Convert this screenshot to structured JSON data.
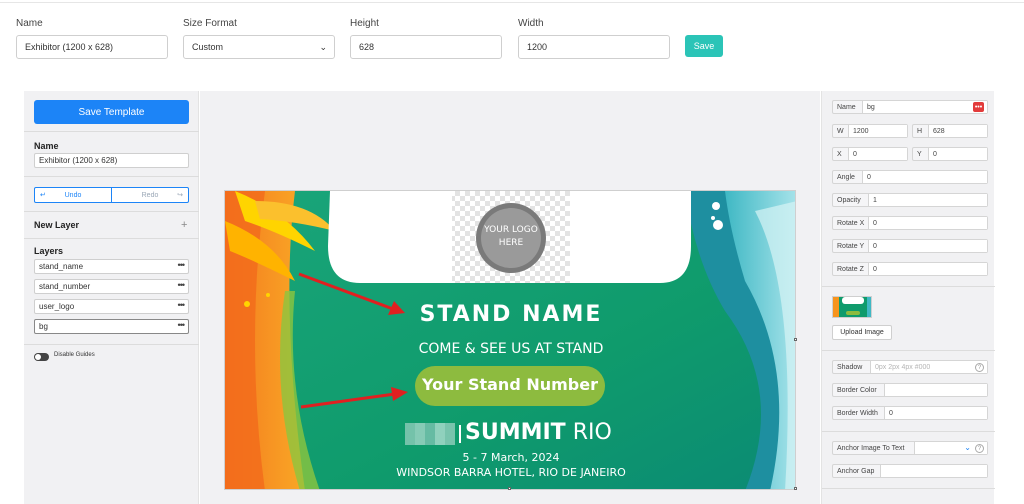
{
  "topbar": {
    "name_label": "Name",
    "name_value": "Exhibitor (1200 x 628)",
    "size_format_label": "Size Format",
    "size_format_value": "Custom",
    "height_label": "Height",
    "height_value": "628",
    "width_label": "Width",
    "width_value": "1200",
    "save_label": "Save"
  },
  "left_panel": {
    "save_template_label": "Save Template",
    "name_heading": "Name",
    "name_value": "Exhibitor (1200 x 628)",
    "undo_label": "Undo",
    "redo_label": "Redo",
    "new_layer_label": "New Layer",
    "layers_heading": "Layers",
    "layers": [
      {
        "label": "stand_name"
      },
      {
        "label": "stand_number"
      },
      {
        "label": "user_logo"
      },
      {
        "label": "bg"
      }
    ],
    "disable_guides_label": "Disable Guides"
  },
  "canvas": {
    "logo_text": "YOUR LOGO HERE",
    "stand_name": "STAND NAME",
    "come_see": "COME & SEE US AT STAND",
    "stand_number": "Your Stand Number",
    "summit": "SUMMIT",
    "city": "RIO",
    "dates": "5 - 7 March, 2024",
    "venue": "WINDSOR BARRA HOTEL, RIO DE JANEIRO",
    "colors": {
      "green": "#0f9b6c",
      "teal": "#2bb3b0",
      "orange": "#f7941d",
      "yellow": "#ffd400",
      "pill": "#8dbb3f",
      "arrow": "#e02020"
    }
  },
  "right_panel": {
    "name_label": "Name",
    "name_value": "bg",
    "w_label": "W",
    "w_value": "1200",
    "h_label": "H",
    "h_value": "628",
    "x_label": "X",
    "x_value": "0",
    "y_label": "Y",
    "y_value": "0",
    "angle_label": "Angle",
    "angle_value": "0",
    "opacity_label": "Opacity",
    "opacity_value": "1",
    "rotate_x_label": "Rotate X",
    "rotate_x_value": "0",
    "rotate_y_label": "Rotate Y",
    "rotate_y_value": "0",
    "rotate_z_label": "Rotate Z",
    "rotate_z_value": "0",
    "upload_label": "Upload Image",
    "shadow_label": "Shadow",
    "shadow_placeholder": "0px 2px 4px #000",
    "border_color_label": "Border Color",
    "border_color_value": "",
    "border_width_label": "Border Width",
    "border_width_value": "0",
    "anchor_label": "Anchor Image To Text",
    "anchor_gap_label": "Anchor Gap",
    "anchor_gap_value": ""
  }
}
